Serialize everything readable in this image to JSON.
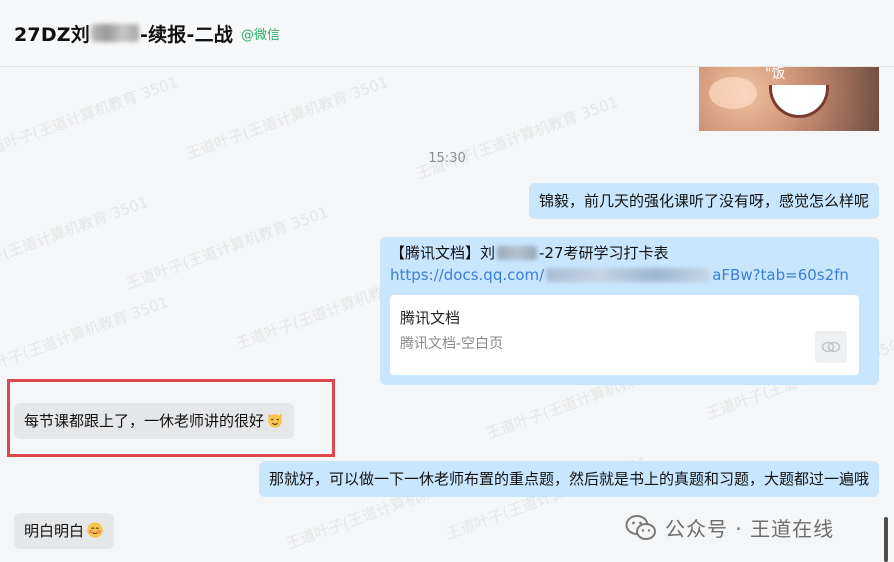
{
  "header": {
    "title_prefix": "27DZ刘",
    "title_suffix": "-续报-二战",
    "source_tag": "@微信"
  },
  "chat": {
    "timestamp": "15:30",
    "messages": {
      "m1": "锦毅，前几天的强化课听了没有呀，感觉怎么样呢",
      "m2_line1_prefix": "【腾讯文档】刘",
      "m2_line1_suffix": " -27考研学习打卡表",
      "m2_link_prefix": "https://docs.qq.com/",
      "m2_link_suffix": "aFBw?tab=60s2fn",
      "m2_card_title": "腾讯文档",
      "m2_card_subtitle": "腾讯文档-空白页",
      "m3": "每节课都跟上了，一休老师讲的很好",
      "m4": "那就好，可以做一下一休老师布置的重点题，然后就是书上的真题和习题，大题都过一遍哦",
      "m5": "明白明白"
    }
  },
  "photo": {
    "tag": "\"饭"
  },
  "official_account": {
    "label": "公众号 · 王道在线"
  },
  "watermark": {
    "text": "王道叶子(王道计算机教育 3501"
  },
  "colors": {
    "self_bubble": "#c9e6ff",
    "other_bubble": "#e6e7e9",
    "highlight_box": "#e0474c",
    "link": "#3b7fd7",
    "wechat_tag": "#2aae67"
  }
}
